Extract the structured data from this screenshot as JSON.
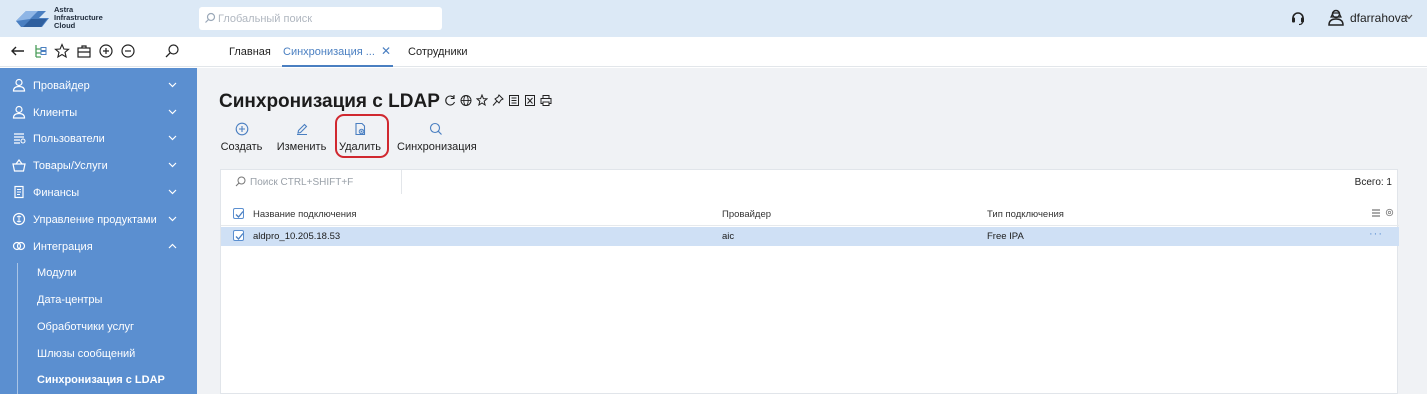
{
  "app": {
    "logo_lines": [
      "Astra",
      "Infrastructure",
      "Cloud"
    ],
    "search_placeholder": "Глобальный поиск",
    "username": "dfarrahova"
  },
  "tabs": [
    {
      "label": "Главная",
      "active": false
    },
    {
      "label": "Синхронизация ...",
      "active": true,
      "closable": true
    },
    {
      "label": "Сотрудники",
      "active": false
    }
  ],
  "tab_close_glyph": "✕",
  "nav_icons": [
    "back-arrow-icon",
    "tree-icon",
    "star-icon",
    "briefcase-icon",
    "zoom-in-icon",
    "zoom-out-icon",
    "search-icon"
  ],
  "sidebar": {
    "items": [
      {
        "label": "Провайдер",
        "icon": "provider-icon",
        "expanded": false
      },
      {
        "label": "Клиенты",
        "icon": "clients-icon",
        "expanded": false
      },
      {
        "label": "Пользователи",
        "icon": "users-icon",
        "expanded": false
      },
      {
        "label": "Товары/Услуги",
        "icon": "basket-icon",
        "expanded": false
      },
      {
        "label": "Финансы",
        "icon": "finance-icon",
        "expanded": false
      },
      {
        "label": "Управление продуктами",
        "icon": "products-icon",
        "expanded": false
      },
      {
        "label": "Интеграция",
        "icon": "integration-icon",
        "expanded": true
      }
    ],
    "subitems": [
      {
        "label": "Модули",
        "active": false
      },
      {
        "label": "Дата-центры",
        "active": false
      },
      {
        "label": "Обработчики услуг",
        "active": false
      },
      {
        "label": "Шлюзы сообщений",
        "active": false
      },
      {
        "label": "Синхронизация с LDAP",
        "active": true
      }
    ]
  },
  "page": {
    "title": "Синхронизация с LDAP",
    "title_icons": [
      "refresh-icon",
      "globe-icon",
      "star-icon",
      "pin-icon",
      "export-icon",
      "excel-icon",
      "print-icon"
    ],
    "actions": [
      {
        "label": "Создать",
        "icon": "plus-circle-icon"
      },
      {
        "label": "Изменить",
        "icon": "pencil-icon"
      },
      {
        "label": "Удалить",
        "icon": "delete-doc-icon"
      },
      {
        "label": "Синхронизация",
        "icon": "search-icon"
      }
    ]
  },
  "grid": {
    "search_placeholder": "Поиск CTRL+SHIFT+F",
    "total": "Всего: 1",
    "columns": [
      "Название подключения",
      "Провайдер",
      "Тип подключения"
    ],
    "rows": [
      {
        "name": "aldpro_10.205.18.53",
        "provider": "aic",
        "type": "Free IPA",
        "selected": true
      }
    ],
    "row_menu": "···"
  },
  "colors": {
    "topbar": "#dce9f6",
    "sidebar": "#5b8fd0",
    "accent": "#4a7fc1",
    "selected_row": "#cfe0f5",
    "highlight_border": "#d0282f"
  }
}
